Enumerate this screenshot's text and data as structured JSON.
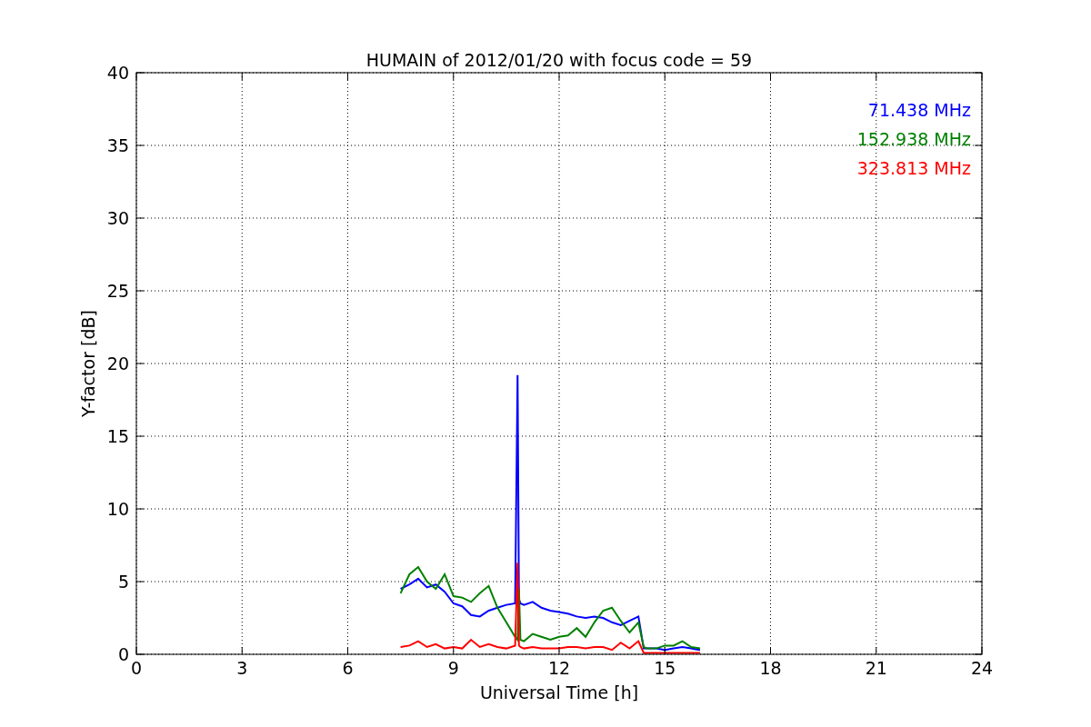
{
  "figure": {
    "chart_data": {
      "type": "line",
      "title": "HUMAIN of 2012/01/20 with focus code = 59",
      "xlabel": "Universal Time [h]",
      "ylabel": "Y-factor [dB]",
      "x": [
        7.5,
        7.75,
        8,
        8.25,
        8.5,
        8.75,
        9,
        9.25,
        9.5,
        9.75,
        10,
        10.25,
        10.5,
        10.75,
        10.82,
        10.86,
        10.9,
        11,
        11.25,
        11.5,
        11.75,
        12,
        12.25,
        12.5,
        12.75,
        13,
        13.25,
        13.5,
        13.75,
        14,
        14.25,
        14.4,
        14.5,
        14.75,
        15,
        15.25,
        15.5,
        15.75,
        16
      ],
      "series": [
        {
          "name": "71.438 MHz",
          "color": "#0000ff",
          "values": [
            4.5,
            4.8,
            5.2,
            4.6,
            4.8,
            4.3,
            3.5,
            3.3,
            2.7,
            2.6,
            3.0,
            3.2,
            3.4,
            3.5,
            19.2,
            3.8,
            3.5,
            3.4,
            3.6,
            3.2,
            3.0,
            2.9,
            2.8,
            2.6,
            2.5,
            2.6,
            2.5,
            2.2,
            2.0,
            2.3,
            2.6,
            0.4,
            0.4,
            0.4,
            0.3,
            0.4,
            0.5,
            0.4,
            0.3
          ]
        },
        {
          "name": "152.938 MHz",
          "color": "#008000",
          "values": [
            4.2,
            5.5,
            6.0,
            5.0,
            4.5,
            5.5,
            4.0,
            3.9,
            3.6,
            4.2,
            4.7,
            3.2,
            2.2,
            1.2,
            1.0,
            4.5,
            1.0,
            0.9,
            1.4,
            1.2,
            1.0,
            1.2,
            1.3,
            1.8,
            1.2,
            2.2,
            3.0,
            3.2,
            2.3,
            1.5,
            2.2,
            0.5,
            0.4,
            0.4,
            0.6,
            0.6,
            0.9,
            0.5,
            0.4
          ]
        },
        {
          "name": "323.813 MHz",
          "color": "#ff0000",
          "values": [
            0.5,
            0.6,
            0.9,
            0.5,
            0.7,
            0.4,
            0.5,
            0.4,
            1.0,
            0.5,
            0.7,
            0.5,
            0.4,
            0.6,
            6.3,
            0.6,
            0.5,
            0.4,
            0.5,
            0.4,
            0.4,
            0.4,
            0.5,
            0.5,
            0.4,
            0.5,
            0.5,
            0.3,
            0.8,
            0.4,
            0.9,
            0.1,
            0.1,
            0.1,
            0.1,
            0.1,
            0.1,
            0.1,
            0.1
          ]
        }
      ],
      "xlim": [
        0,
        24
      ],
      "ylim": [
        0,
        40
      ],
      "xticks": [
        0,
        3,
        6,
        9,
        12,
        15,
        18,
        21,
        24
      ],
      "yticks": [
        0,
        5,
        10,
        15,
        20,
        25,
        30,
        35,
        40
      ],
      "grid": true
    }
  }
}
